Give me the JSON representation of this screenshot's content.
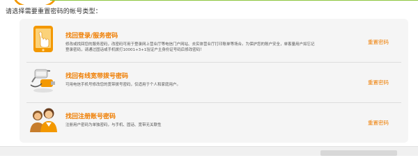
{
  "prompt": "请选择需要重置密码的帐号类型：",
  "options": [
    {
      "icon": "phone-icon",
      "title": "找回登录/服务密码",
      "desc": "修改或找回您的服务密码，改密码可用于登录网上营业厅等电信门户网站、去实体营业厅打印账单等场合。为保护您的账户安全，单客量用户如忘记登录密码，请通过固话或手机拨打10001+3+1验证户主身份证号码后修改密码！",
      "action": "重置密码"
    },
    {
      "icon": "broadband-plug-icon",
      "title": "找回有线宽带拨号密码",
      "desc": "可用电信手机号修改您的宽带拨号密码，仅适用于个人和家庭用户。",
      "action": "重置密码"
    },
    {
      "icon": "users-icon",
      "title": "找回注册账号密码",
      "desc": "注册用户密码为单独密码，与手机、固话、宽带无关联性",
      "action": "重置密码"
    }
  ]
}
